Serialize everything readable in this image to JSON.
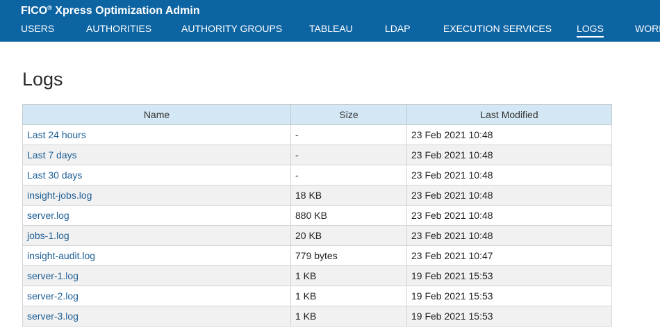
{
  "header": {
    "title": "FICO",
    "title_mark": "®",
    "title_rest": " Xpress Optimization Admin",
    "nav": [
      {
        "label": "USERS"
      },
      {
        "label": "AUTHORITIES"
      },
      {
        "label": "AUTHORITY GROUPS"
      },
      {
        "label": "TABLEAU"
      },
      {
        "label": "LDAP"
      },
      {
        "label": "EXECUTION SERVICES"
      },
      {
        "label": "LOGS"
      },
      {
        "label": "WORK"
      }
    ],
    "active_nav": "LOGS",
    "colors": {
      "bar": "#0d64a3",
      "text": "#ffffff"
    }
  },
  "page": {
    "title": "Logs"
  },
  "table": {
    "columns": [
      "Name",
      "Size",
      "Last Modified"
    ],
    "rows": [
      {
        "name": "Last 24 hours",
        "size": "-",
        "modified": "23 Feb 2021 10:48"
      },
      {
        "name": "Last 7 days",
        "size": "-",
        "modified": "23 Feb 2021 10:48"
      },
      {
        "name": "Last 30 days",
        "size": "-",
        "modified": "23 Feb 2021 10:48"
      },
      {
        "name": "insight-jobs.log",
        "size": "18 KB",
        "modified": "23 Feb 2021 10:48"
      },
      {
        "name": "server.log",
        "size": "880 KB",
        "modified": "23 Feb 2021 10:48"
      },
      {
        "name": "jobs-1.log",
        "size": "20 KB",
        "modified": "23 Feb 2021 10:48"
      },
      {
        "name": "insight-audit.log",
        "size": "779 bytes",
        "modified": "23 Feb 2021 10:47"
      },
      {
        "name": "server-1.log",
        "size": "1 KB",
        "modified": "19 Feb 2021 15:53"
      },
      {
        "name": "server-2.log",
        "size": "1 KB",
        "modified": "19 Feb 2021 15:53"
      },
      {
        "name": "server-3.log",
        "size": "1 KB",
        "modified": "19 Feb 2021 15:53"
      }
    ],
    "colors": {
      "header_bg": "#d3e7f4",
      "link": "#1d5e95",
      "zebra": "#f1f1f1"
    }
  }
}
